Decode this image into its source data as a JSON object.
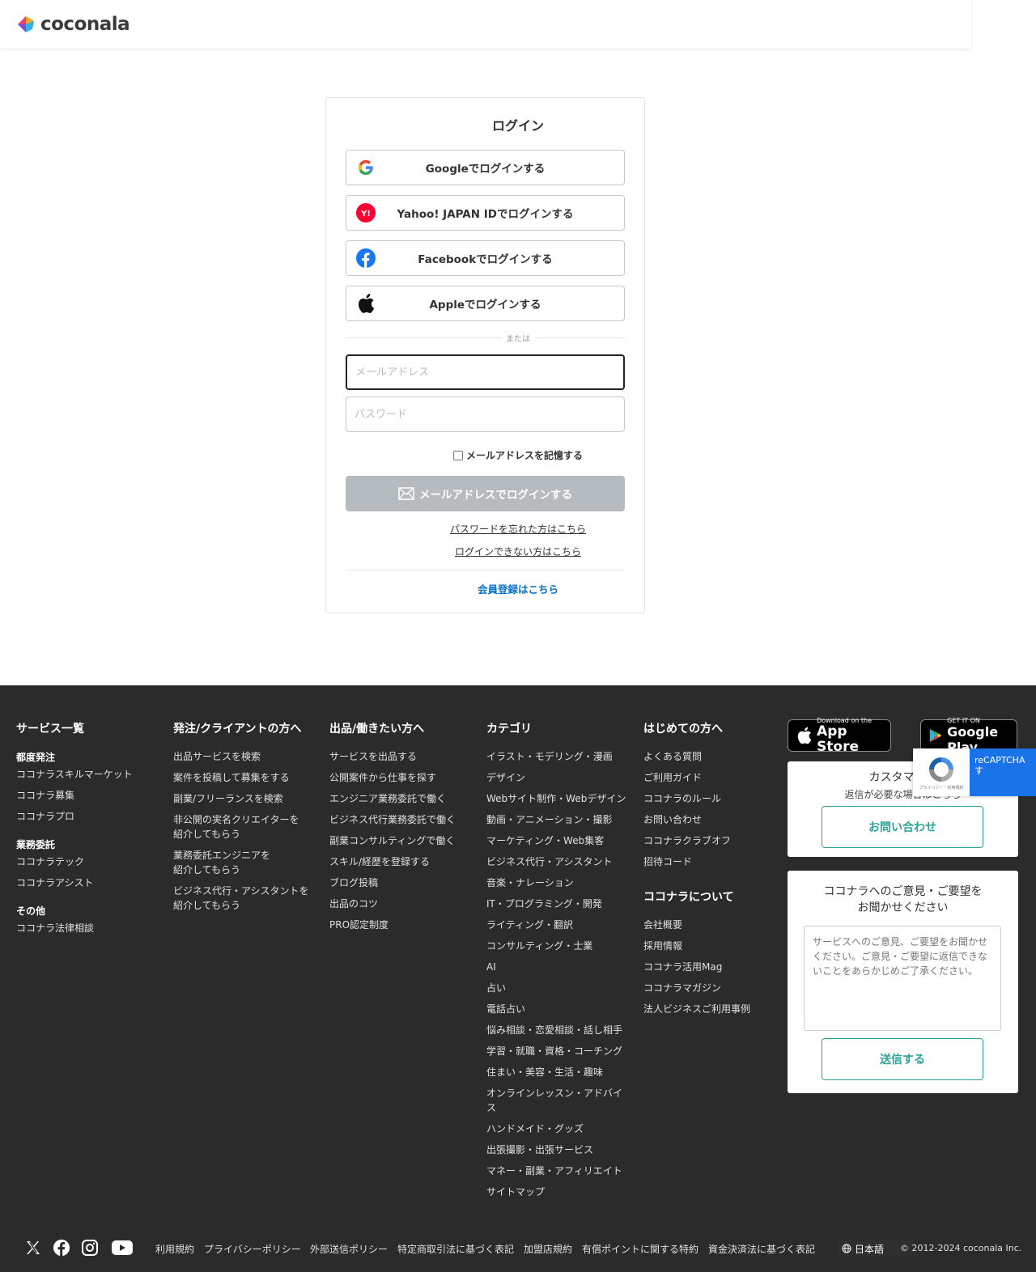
{
  "header": {
    "logo_text": "coconala"
  },
  "login": {
    "title": "ログイン",
    "google": "Googleでログインする",
    "yahoo": "Yahoo! JAPAN IDでログインする",
    "facebook": "Facebookでログインする",
    "apple": "Appleでログインする",
    "or": "または",
    "email_placeholder": "メールアドレス",
    "password_placeholder": "パスワード",
    "remember": "メールアドレスを記憶する",
    "email_login": "メールアドレスでログインする",
    "forgot": "パスワードを忘れた方はこちら",
    "cannot_login": "ログインできない方はこちら",
    "signup": "会員登録はこちら"
  },
  "footer": {
    "col1": {
      "title": "サービス一覧",
      "groups": [
        {
          "title": "都度発注",
          "items": [
            "ココナラスキルマーケット",
            "ココナラ募集",
            "ココナラプロ"
          ]
        },
        {
          "title": "業務委託",
          "items": [
            "ココナラテック",
            "ココナラアシスト"
          ]
        },
        {
          "title": "その他",
          "items": [
            "ココナラ法律相談"
          ]
        }
      ]
    },
    "col2": {
      "title": "発注/クライアントの方へ",
      "items": [
        "出品サービスを検索",
        "案件を投稿して募集をする",
        "副業/フリーランスを検索",
        "非公開の実名クリエイターを",
        "紹介してもらう",
        "業務委託エンジニアを",
        "紹介してもらう",
        "ビジネス代行・アシスタントを",
        "紹介してもらう"
      ]
    },
    "col3": {
      "title": "出品/働きたい方へ",
      "items": [
        "サービスを出品する",
        "公開案件から仕事を探す",
        "エンジニア業務委託で働く",
        "ビジネス代行業務委託で働く",
        "副業コンサルティングで働く",
        "スキル/経歴を登録する",
        "ブログ投稿",
        "出品のコツ",
        "PRO認定制度"
      ]
    },
    "col4": {
      "title": "カテゴリ",
      "items": [
        "イラスト・モデリング・漫画",
        "デザイン",
        "Webサイト制作・Webデザイン",
        "動画・アニメーション・撮影",
        "マーケティング・Web集客",
        "ビジネス代行・アシスタント",
        "音楽・ナレーション",
        "IT・プログラミング・開発",
        "ライティング・翻訳",
        "コンサルティング・士業",
        "AI",
        "占い",
        "電話占い",
        "悩み相談・恋愛相談・話し相手",
        "学習・就職・資格・コーチング",
        "住まい・美容・生活・趣味",
        "オンラインレッスン・アドバイ",
        "ス",
        "ハンドメイド・グッズ",
        "出張撮影・出張サービス",
        "マネー・副業・アフィリエイト",
        "サイトマップ"
      ]
    },
    "col5": {
      "title": "はじめての方へ",
      "items": [
        "よくある質問",
        "ご利用ガイド",
        "ココナラのルール",
        "お問い合わせ",
        "ココナラクラブオフ",
        "招待コード"
      ],
      "title2": "ココナラについて",
      "items2": [
        "会社概要",
        "採用情報",
        "ココナラ活用Mag",
        "ココナラマガジン",
        "法人ビジネスご利用事例"
      ]
    },
    "appstore": {
      "small": "Download on the",
      "big": "App Store"
    },
    "googleplay": {
      "small": "GET IT ON",
      "big": "Google Play"
    },
    "support": {
      "title": "カスタマーサ",
      "sub": "返信が必要な場合はこちら",
      "button": "お問い合わせ"
    },
    "feedback": {
      "title1": "ココナラへのご意見・ご要望を",
      "title2": "お聞かせください",
      "placeholder": "サービスへのご意見、ご要望をお聞かせください。ご意見・ご要望に返信できないことをあらかじめご了承ください。",
      "button": "送信する"
    },
    "recaptcha": {
      "label": "reCAPTCHA",
      "sub": "す",
      "privacy": "プライバシー・利用規約"
    }
  },
  "bottom": {
    "links": [
      "利用規約",
      "プライバシーポリシー",
      "外部送信ポリシー",
      "特定商取引法に基づく表記",
      "加盟店規約",
      "有償ポイントに関する特約",
      "資金決済法に基づく表記"
    ],
    "lang": "日本語",
    "copyright": "© 2012-2024 coconala Inc."
  }
}
